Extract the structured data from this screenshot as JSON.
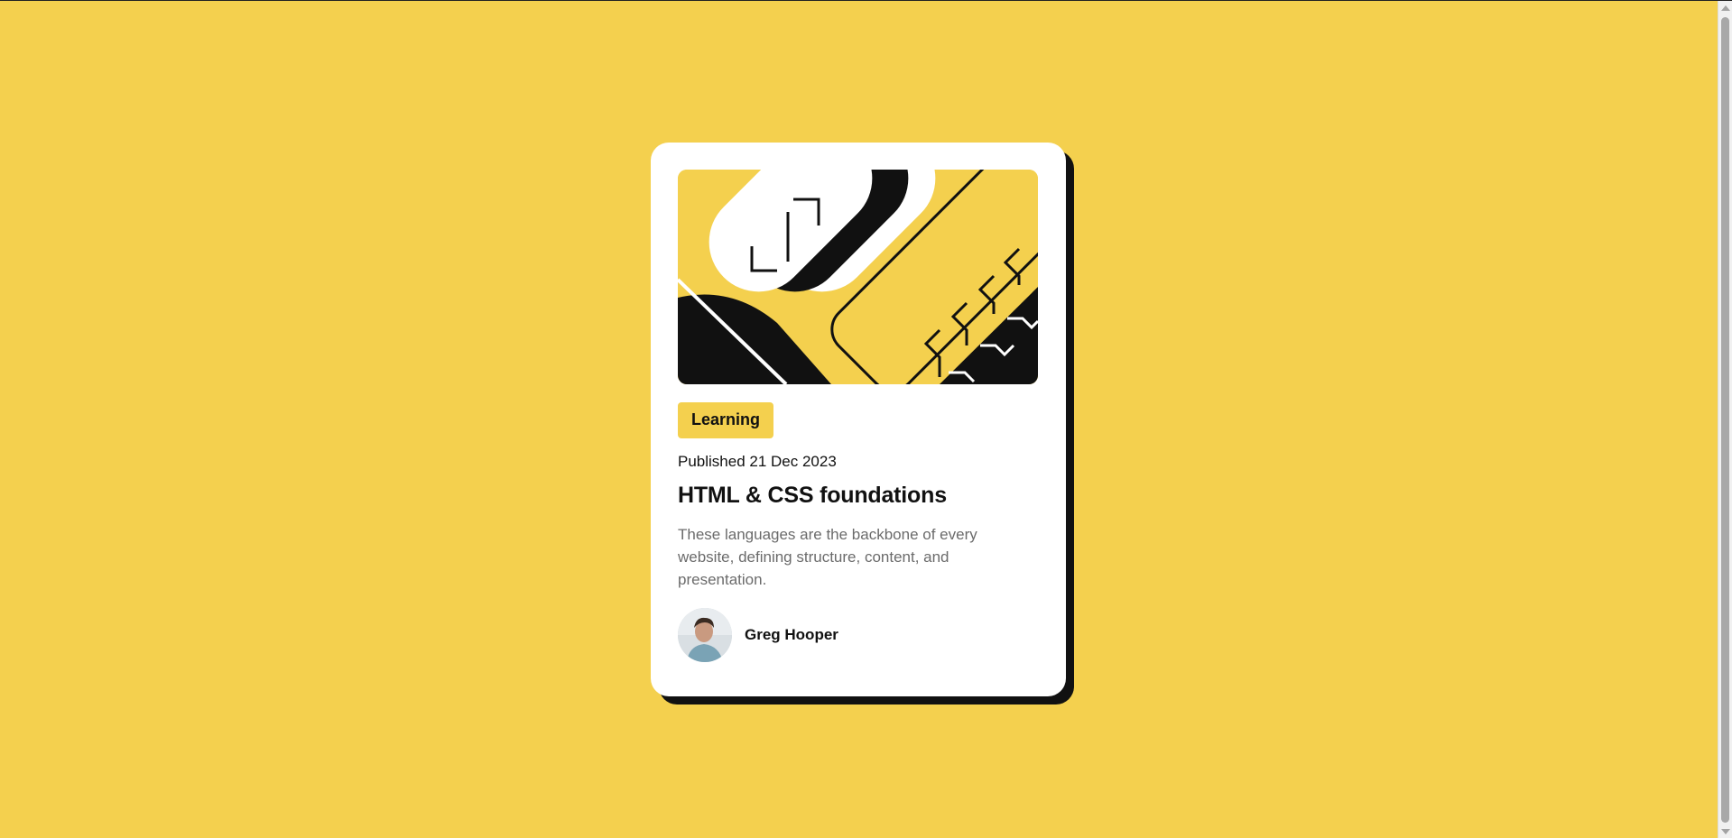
{
  "card": {
    "tag": "Learning",
    "published": "Published 21 Dec 2023",
    "title": "HTML & CSS foundations",
    "description": "These languages are the backbone of every website, defining structure, content, and presentation.",
    "author": {
      "name": "Greg Hooper"
    }
  },
  "colors": {
    "background": "#f4d04e",
    "card": "#ffffff",
    "shadow": "#111111",
    "text": "#111111",
    "muted": "#6b6b6b"
  },
  "icons": [
    "illustration-image",
    "avatar-image"
  ]
}
